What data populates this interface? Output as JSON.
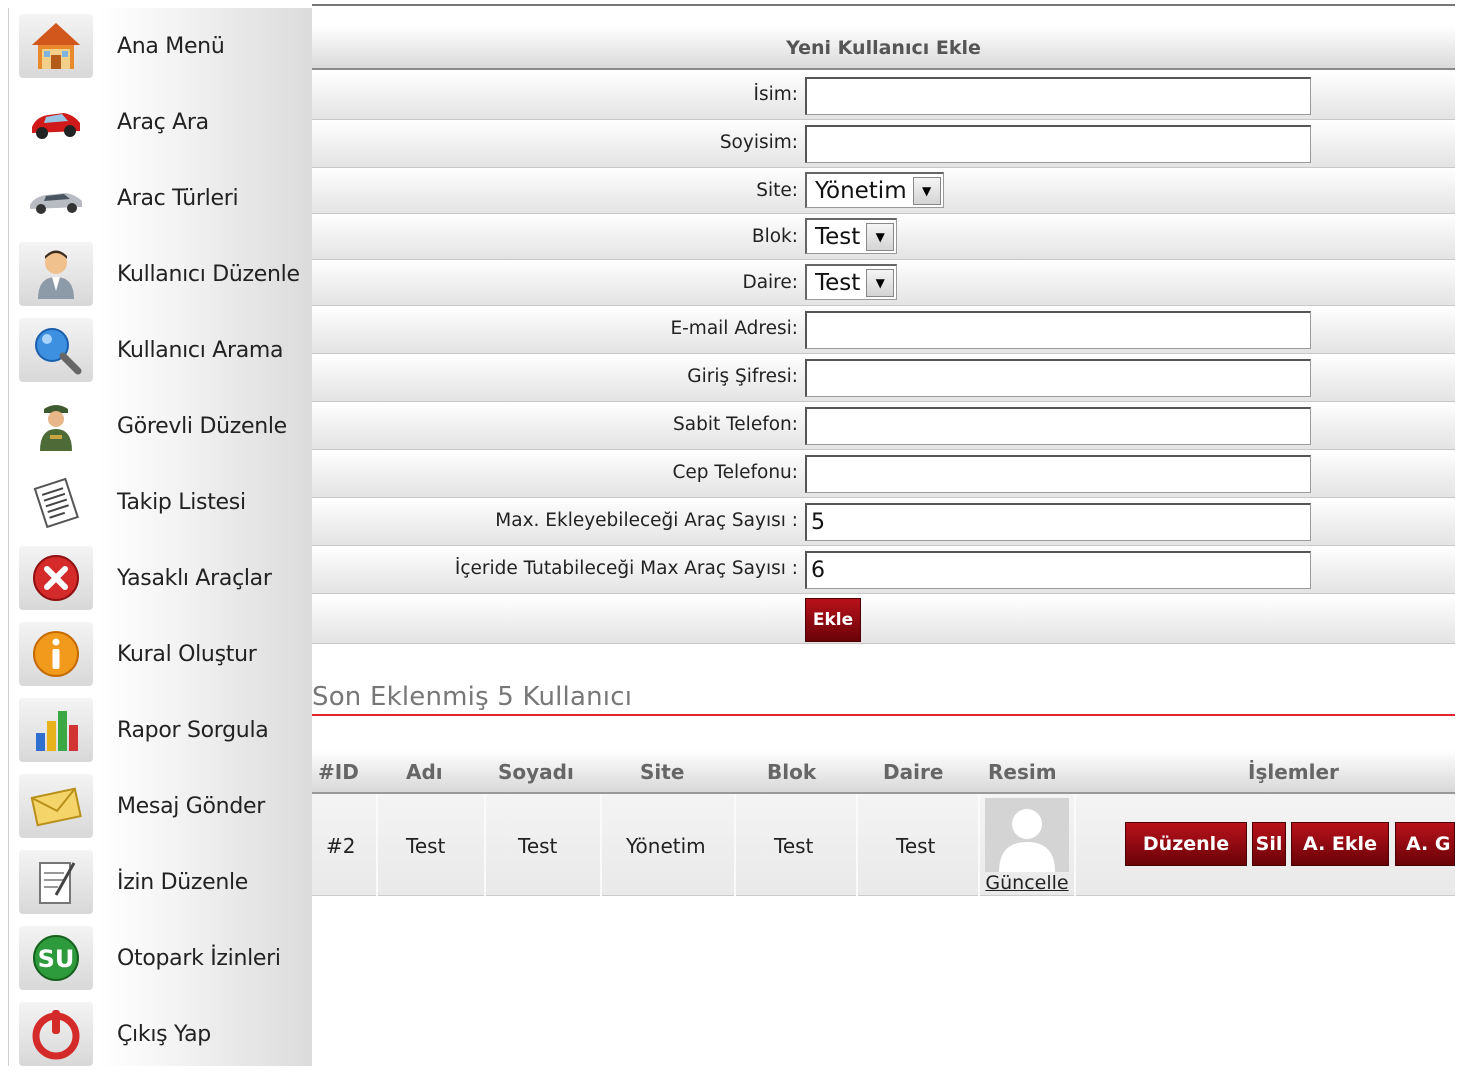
{
  "sidebar": {
    "items": [
      {
        "label": "Ana Menü",
        "icon": "home-icon"
      },
      {
        "label": "Araç Ara",
        "icon": "red-car-icon"
      },
      {
        "label": "Arac Türleri",
        "icon": "silver-car-icon"
      },
      {
        "label": "Kullanıcı Düzenle",
        "icon": "user-icon"
      },
      {
        "label": "Kullanıcı Arama",
        "icon": "magnifier-icon"
      },
      {
        "label": "Görevli Düzenle",
        "icon": "officer-icon"
      },
      {
        "label": "Takip Listesi",
        "icon": "list-icon"
      },
      {
        "label": "Yasaklı Araçlar",
        "icon": "forbidden-icon"
      },
      {
        "label": "Kural Oluştur",
        "icon": "info-icon"
      },
      {
        "label": "Rapor Sorgula",
        "icon": "report-chart-icon"
      },
      {
        "label": "Mesaj Gönder",
        "icon": "envelope-icon"
      },
      {
        "label": "İzin Düzenle",
        "icon": "document-edit-icon"
      },
      {
        "label": "Otopark İzinleri",
        "icon": "parking-permit-icon"
      },
      {
        "label": "Çıkış Yap",
        "icon": "power-icon"
      }
    ]
  },
  "form": {
    "title": "Yeni Kullanıcı Ekle",
    "fields": {
      "isim": {
        "label": "İsim:",
        "value": ""
      },
      "soyisim": {
        "label": "Soyisim:",
        "value": ""
      },
      "site": {
        "label": "Site:",
        "value": "Yönetim"
      },
      "blok": {
        "label": "Blok:",
        "value": "Test"
      },
      "daire": {
        "label": "Daire:",
        "value": "Test"
      },
      "email": {
        "label": "E-mail Adresi:",
        "value": ""
      },
      "sifre": {
        "label": "Giriş Şifresi:",
        "value": ""
      },
      "sabit_tel": {
        "label": "Sabit Telefon:",
        "value": ""
      },
      "cep_tel": {
        "label": "Cep Telefonu:",
        "value": ""
      },
      "max_ekle": {
        "label": "Max. Ekleyebileceği Araç Sayısı :",
        "value": "5"
      },
      "max_icerde": {
        "label": "İçeride Tutabileceği Max Araç Sayısı :",
        "value": "6"
      }
    },
    "submit_label": "Ekle"
  },
  "recent": {
    "title": "Son Eklenmiş 5 Kullanıcı",
    "headers": {
      "id": "#ID",
      "adi": "Adı",
      "soyadi": "Soyadı",
      "site": "Site",
      "blok": "Blok",
      "daire": "Daire",
      "resim": "Resim",
      "islemler": "İşlemler"
    },
    "rows": [
      {
        "id": "#2",
        "adi": "Test",
        "soyadi": "Test",
        "site": "Yönetim",
        "blok": "Test",
        "daire": "Test",
        "resim_link": "Güncelle",
        "actions": [
          "Düzenle",
          "Sil",
          "A. Ekle",
          "A. G"
        ]
      }
    ]
  },
  "colors": {
    "accent_red": "#a50e16",
    "section_rule": "#e4232a",
    "header_text": "#555555"
  }
}
